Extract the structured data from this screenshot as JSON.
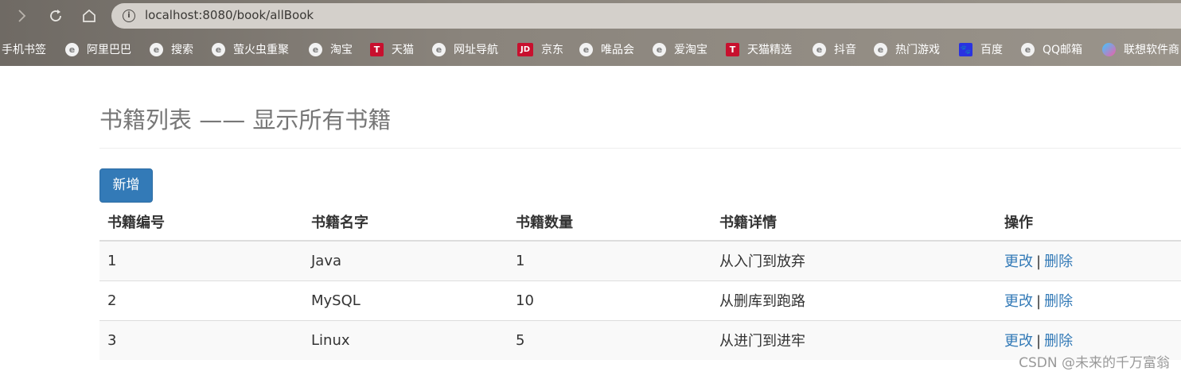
{
  "browser": {
    "url": "localhost:8080/book/allBook",
    "bookmarks": [
      {
        "label": "手机书签",
        "icon": "none"
      },
      {
        "label": "阿里巴巴",
        "icon": "e-icon"
      },
      {
        "label": "搜索",
        "icon": "e-icon"
      },
      {
        "label": "萤火虫重聚",
        "icon": "e-icon"
      },
      {
        "label": "淘宝",
        "icon": "e-icon"
      },
      {
        "label": "天猫",
        "icon": "tmall-icon"
      },
      {
        "label": "网址导航",
        "icon": "e-icon"
      },
      {
        "label": "京东",
        "icon": "jd-icon"
      },
      {
        "label": "唯品会",
        "icon": "e-icon"
      },
      {
        "label": "爱淘宝",
        "icon": "e-icon"
      },
      {
        "label": "天猫精选",
        "icon": "tmall-icon"
      },
      {
        "label": "抖音",
        "icon": "e-icon"
      },
      {
        "label": "热门游戏",
        "icon": "e-icon"
      },
      {
        "label": "百度",
        "icon": "baidu-icon"
      },
      {
        "label": "QQ邮箱",
        "icon": "e-icon"
      },
      {
        "label": "联想软件商",
        "icon": "lenovo-icon"
      }
    ],
    "icon_glyphs": {
      "tmall": "T",
      "jd": "JD",
      "baidu": "🐾"
    }
  },
  "page": {
    "title": "书籍列表 —— 显示所有书籍",
    "add_button": "新增",
    "table": {
      "headers": [
        "书籍编号",
        "书籍名字",
        "书籍数量",
        "书籍详情",
        "操作"
      ],
      "rows": [
        {
          "id": "1",
          "name": "Java",
          "count": "1",
          "detail": "从入门到放弃"
        },
        {
          "id": "2",
          "name": "MySQL",
          "count": "10",
          "detail": "从删库到跑路"
        },
        {
          "id": "3",
          "name": "Linux",
          "count": "5",
          "detail": "从进门到进牢"
        }
      ],
      "actions": {
        "edit": "更改",
        "separator": "|",
        "delete": "删除"
      }
    },
    "watermark": "CSDN @未来的千万富翁"
  },
  "colors": {
    "primary": "#337ab7",
    "title_gray": "#777777"
  }
}
